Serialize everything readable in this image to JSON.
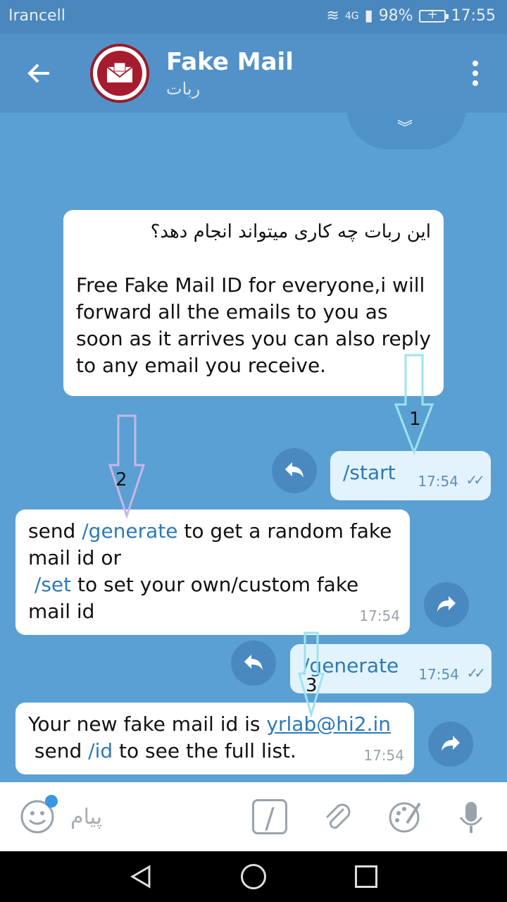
{
  "status": {
    "carrier": "Irancell",
    "network": "4G",
    "battery": "98%",
    "time": "17:55"
  },
  "header": {
    "title": "Fake Mail",
    "subtitle": "ربات"
  },
  "messages": {
    "m1": {
      "line1": "این ربات چه کاری میتواند انجام دهد؟",
      "line2": "Free Fake Mail ID for everyone,i will forward all the emails to you as soon as it arrives you can also reply to any email you receive."
    },
    "m2": {
      "text": "/start",
      "time": "17:54"
    },
    "m3": {
      "p1": "send ",
      "cmd1": "/generate",
      "p2": " to get a random fake mail id or",
      "cmd2": "/set",
      "p3": " to set your own/custom fake mail id",
      "time": "17:54"
    },
    "m4": {
      "text": "/generate",
      "time": "17:54"
    },
    "m5": {
      "p1": "Your new fake mail id is ",
      "email": "yrlab@hi2.in",
      "p2": "send ",
      "cmd": "/id",
      "p3": " to see the full list.",
      "time": "17:54"
    }
  },
  "annotations": {
    "a1": "1",
    "a2": "2",
    "a3": "3"
  },
  "input": {
    "placeholder": "پیام"
  },
  "colors": {
    "header": "#5392c8",
    "chat_bg": "#5ba0d2",
    "command": "#2d79b8"
  }
}
